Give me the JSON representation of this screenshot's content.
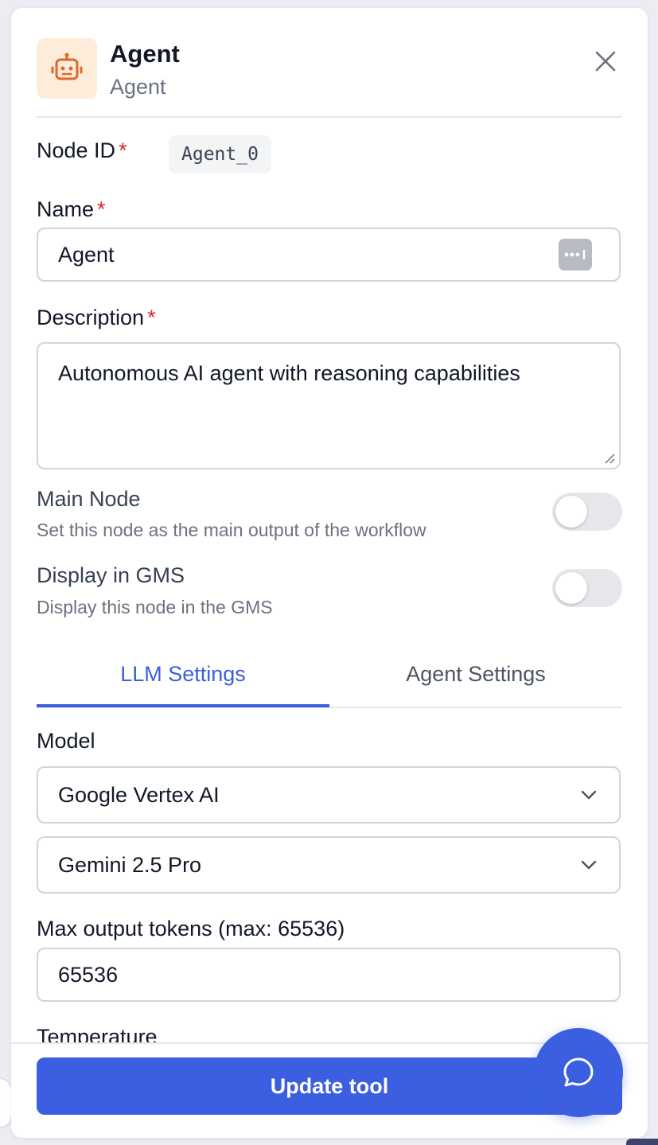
{
  "header": {
    "title": "Agent",
    "subtitle": "Agent",
    "icon": "robot-icon"
  },
  "node_id": {
    "label": "Node ID",
    "required_mark": "*",
    "value": "Agent_0"
  },
  "name": {
    "label": "Name",
    "required_mark": "*",
    "value": "Agent"
  },
  "description": {
    "label": "Description",
    "required_mark": "*",
    "value": "Autonomous AI agent with reasoning capabilities"
  },
  "main_node": {
    "title": "Main Node",
    "description": "Set this node as the main output of the workflow",
    "enabled": false
  },
  "display_gms": {
    "title": "Display in GMS",
    "description": "Display this node in the GMS",
    "enabled": false
  },
  "tabs": [
    {
      "label": "LLM Settings",
      "active": true
    },
    {
      "label": "Agent Settings",
      "active": false
    }
  ],
  "model": {
    "label": "Model",
    "provider": "Google Vertex AI",
    "model_name": "Gemini 2.5 Pro"
  },
  "max_tokens": {
    "label": "Max output tokens (max: 65536)",
    "value": "65536"
  },
  "temperature": {
    "label": "Temperature"
  },
  "footer": {
    "update_label": "Update tool"
  },
  "colors": {
    "accent": "#3b5fe0",
    "required": "#dc2626",
    "icon_bg": "#fdecd9",
    "icon_fg": "#e0662a"
  }
}
